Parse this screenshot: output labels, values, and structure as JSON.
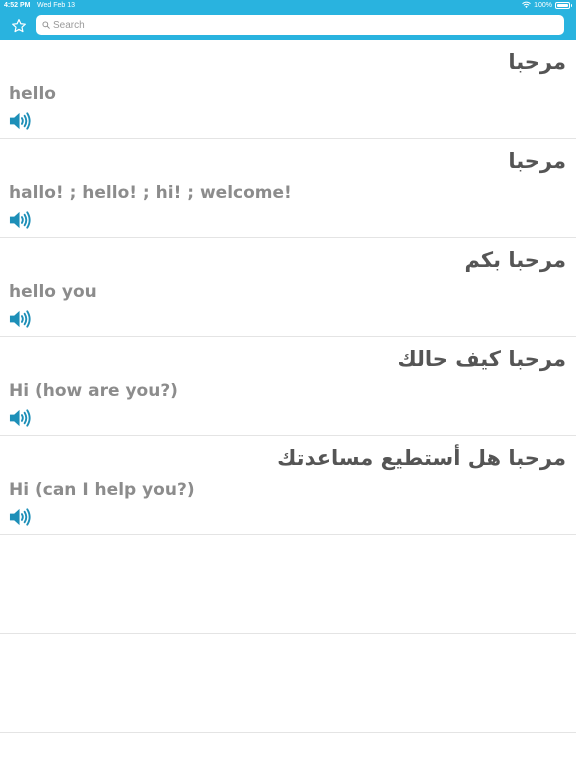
{
  "status_bar": {
    "time": "4:52 PM",
    "date": "Wed Feb 13",
    "battery_label": "100%",
    "battery_level": 1.0
  },
  "toolbar": {
    "favorite_icon": "star-icon",
    "search_placeholder": "Search",
    "search_value": ""
  },
  "colors": {
    "accent": "#29b3df",
    "speaker": "#1d8fb8",
    "arabic_text": "#555555",
    "english_text": "#8c8c8c",
    "divider": "#e4e4e4"
  },
  "entries": [
    {
      "arabic": "مرحبا",
      "english": "hello",
      "audio_icon": "speaker-icon"
    },
    {
      "arabic": "مرحبا",
      "english": "hallo! ; hello! ; hi! ; welcome!",
      "audio_icon": "speaker-icon"
    },
    {
      "arabic": "مرحبا بكم",
      "english": "hello you",
      "audio_icon": "speaker-icon"
    },
    {
      "arabic": "مرحبا كيف حالك",
      "english": "Hi (how are you?)",
      "audio_icon": "speaker-icon"
    },
    {
      "arabic": "مرحبا هل أستطيع مساعدتك",
      "english": "Hi (can I help you?)",
      "audio_icon": "speaker-icon"
    }
  ]
}
